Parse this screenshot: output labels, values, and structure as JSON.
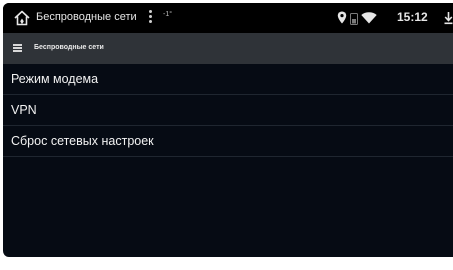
{
  "status_bar": {
    "title": "Беспроводные сети",
    "temperature": "-1°",
    "time": "15:12",
    "icons": [
      "home-icon",
      "more-vert-icon",
      "location-icon",
      "signal-icon",
      "wifi-icon",
      "download-icon"
    ]
  },
  "app_bar": {
    "title": "Беспроводные сети",
    "menu_icon": "hamburger-menu-icon"
  },
  "list": {
    "items": [
      {
        "label": "Режим модема"
      },
      {
        "label": "VPN"
      },
      {
        "label": "Сброс сетевых настроек"
      }
    ]
  },
  "colors": {
    "background": "#060b14",
    "status_bar": "#000000",
    "app_bar": "#2f3338",
    "text": "#f2f2f2",
    "divider": "#1f2630"
  }
}
